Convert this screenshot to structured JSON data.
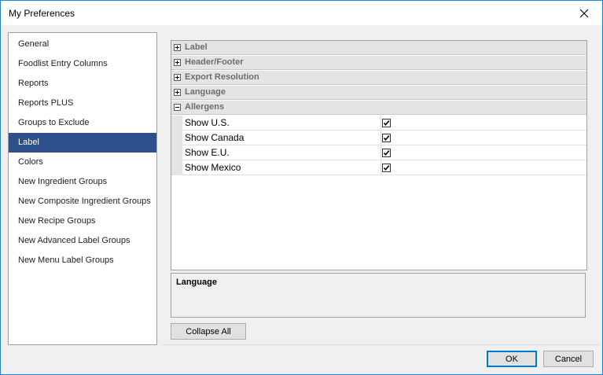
{
  "window": {
    "title": "My Preferences"
  },
  "nav": {
    "items": [
      {
        "label": "General",
        "selected": false
      },
      {
        "label": "Foodlist Entry Columns",
        "selected": false
      },
      {
        "label": "Reports",
        "selected": false
      },
      {
        "label": "Reports PLUS",
        "selected": false
      },
      {
        "label": "Groups to Exclude",
        "selected": false
      },
      {
        "label": "Label",
        "selected": true
      },
      {
        "label": "Colors",
        "selected": false
      },
      {
        "label": "New Ingredient Groups",
        "selected": false
      },
      {
        "label": "New Composite Ingredient Groups",
        "selected": false
      },
      {
        "label": "New Recipe Groups",
        "selected": false
      },
      {
        "label": "New Advanced Label Groups",
        "selected": false
      },
      {
        "label": "New Menu Label Groups",
        "selected": false
      }
    ]
  },
  "grid": {
    "categories": [
      {
        "label": "Label",
        "expanded": false
      },
      {
        "label": "Header/Footer",
        "expanded": false
      },
      {
        "label": "Export Resolution",
        "expanded": false
      },
      {
        "label": "Language",
        "expanded": false
      },
      {
        "label": "Allergens",
        "expanded": true
      }
    ],
    "properties": [
      {
        "name": "Show U.S.",
        "checked": true
      },
      {
        "name": "Show Canada",
        "checked": true
      },
      {
        "name": "Show E.U.",
        "checked": true
      },
      {
        "name": "Show Mexico",
        "checked": true
      }
    ]
  },
  "description": {
    "title": "Language"
  },
  "buttons": {
    "collapse_all": "Collapse All",
    "ok": "OK",
    "cancel": "Cancel"
  },
  "colors": {
    "selection": "#2d4f8a",
    "window_border": "#1883d7",
    "default_button_border": "#0078d7"
  }
}
